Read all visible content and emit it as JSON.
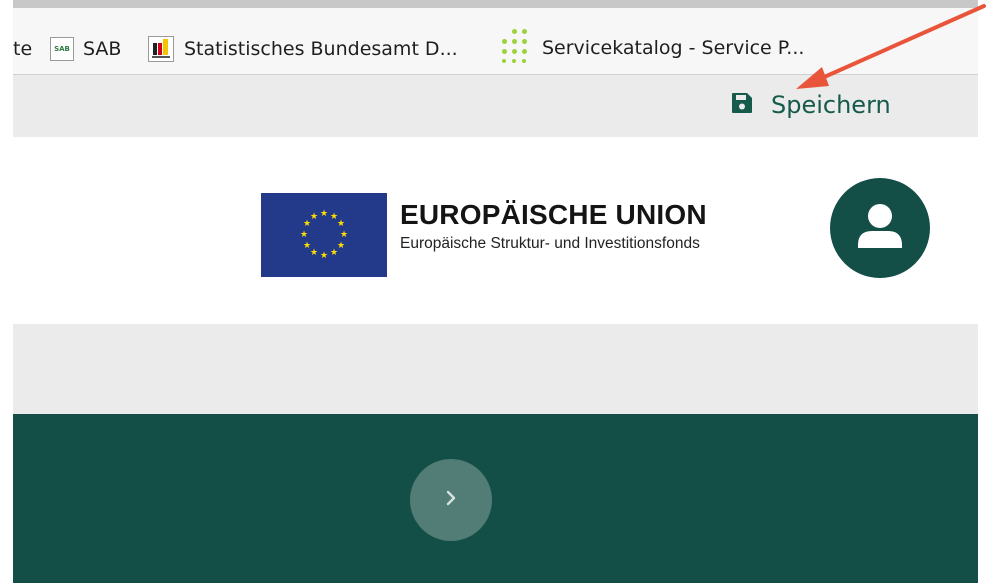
{
  "bookmarks": {
    "partial_label": "te",
    "items": [
      {
        "icon_text": "SAB",
        "label": "SAB",
        "icon": "sab-icon"
      },
      {
        "label": "Statistisches Bundesamt D...",
        "icon": "destatis-icon"
      },
      {
        "label": "Servicekatalog - Service P...",
        "icon": "dots-icon"
      }
    ]
  },
  "toolbar": {
    "save_label": "Speichern",
    "save_icon": "floppy-disk-icon"
  },
  "header": {
    "eu_title": "EUROPÄISCHE UNION",
    "eu_subtitle": "Europäische Struktur- und Investitionsfonds",
    "avatar_icon": "user-icon"
  },
  "navigation": {
    "next_icon": "chevron-right-icon"
  },
  "colors": {
    "brand_green": "#134f47",
    "accent_text": "#165a4c",
    "eu_blue": "#233a8b",
    "eu_star": "#ffdd00",
    "annotation_arrow": "#e8553a"
  }
}
